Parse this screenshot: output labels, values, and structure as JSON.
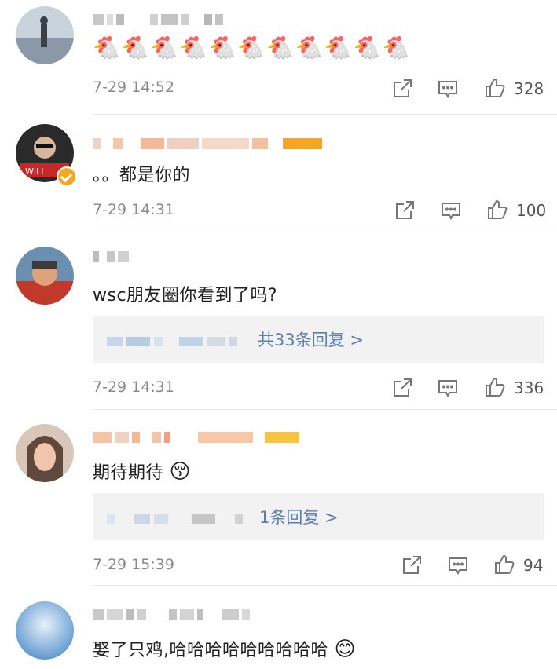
{
  "comments": [
    {
      "text": "🐔🐔🐔🐔🐔🐔🐔🐔🐔🐔🐔",
      "time": "7-29 14:52",
      "likes": "328"
    },
    {
      "text": "。。都是你的",
      "time": "7-29 14:31",
      "likes": "100"
    },
    {
      "text": "wsc朋友圈你看到了吗?",
      "reply_link": "共33条回复 >",
      "time": "7-29 14:31",
      "likes": "336"
    },
    {
      "text": "期待期待",
      "reply_link": "1条回复 >",
      "time": "7-29 15:39",
      "likes": "94"
    },
    {
      "text": "娶了只鸡,哈哈哈哈哈哈哈哈哈"
    }
  ],
  "icons": {
    "share": "share-icon",
    "comment": "comment-icon",
    "like": "thumbs-up-icon",
    "verified": "verified-badge-icon",
    "emoji_kiss": "kissing-face-emoji",
    "emoji_smile": "smiling-face-emoji"
  },
  "colors": {
    "link": "#5b7fb3",
    "timestamp": "#8a8a8a",
    "reply_bg": "#f2f2f2",
    "verified_badge": "#f5a623"
  }
}
